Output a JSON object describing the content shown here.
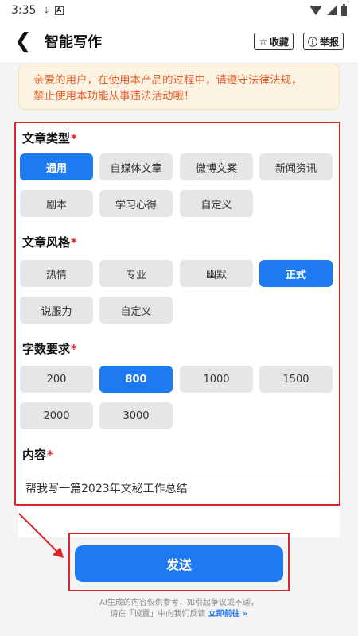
{
  "status_bar": {
    "time": "3:35"
  },
  "nav": {
    "title": "智能写作",
    "favorite_label": "收藏",
    "report_label": "举报"
  },
  "notice": {
    "line1": "亲爱的用户，在使用本产品的过程中，请遵守法律法规，",
    "line2": "禁止使用本功能从事违法活动哦！"
  },
  "article_type": {
    "title": "文章类型",
    "options": [
      "通用",
      "自媒体文章",
      "微博文案",
      "新闻资讯",
      "剧本",
      "学习心得",
      "自定义"
    ],
    "selected": "通用"
  },
  "article_style": {
    "title": "文章风格",
    "options": [
      "热情",
      "专业",
      "幽默",
      "正式",
      "说服力",
      "自定义"
    ],
    "selected": "正式"
  },
  "word_count": {
    "title": "字数要求",
    "options": [
      "200",
      "800",
      "1000",
      "1500",
      "2000",
      "3000"
    ],
    "selected": "800"
  },
  "content": {
    "title": "内容",
    "value": "帮我写一篇2023年文秘工作总结"
  },
  "required_mark": "*",
  "send_label": "发送",
  "footer": {
    "line1": "AI生成的内容仅供参考，如引起争议或不适，",
    "line2_prefix": "请在「设置」中向我们反馈",
    "link": "立即前往 »"
  },
  "colors": {
    "accent": "#1e7af0",
    "highlight_border": "#d8262b",
    "notice_text": "#e85d2c"
  }
}
